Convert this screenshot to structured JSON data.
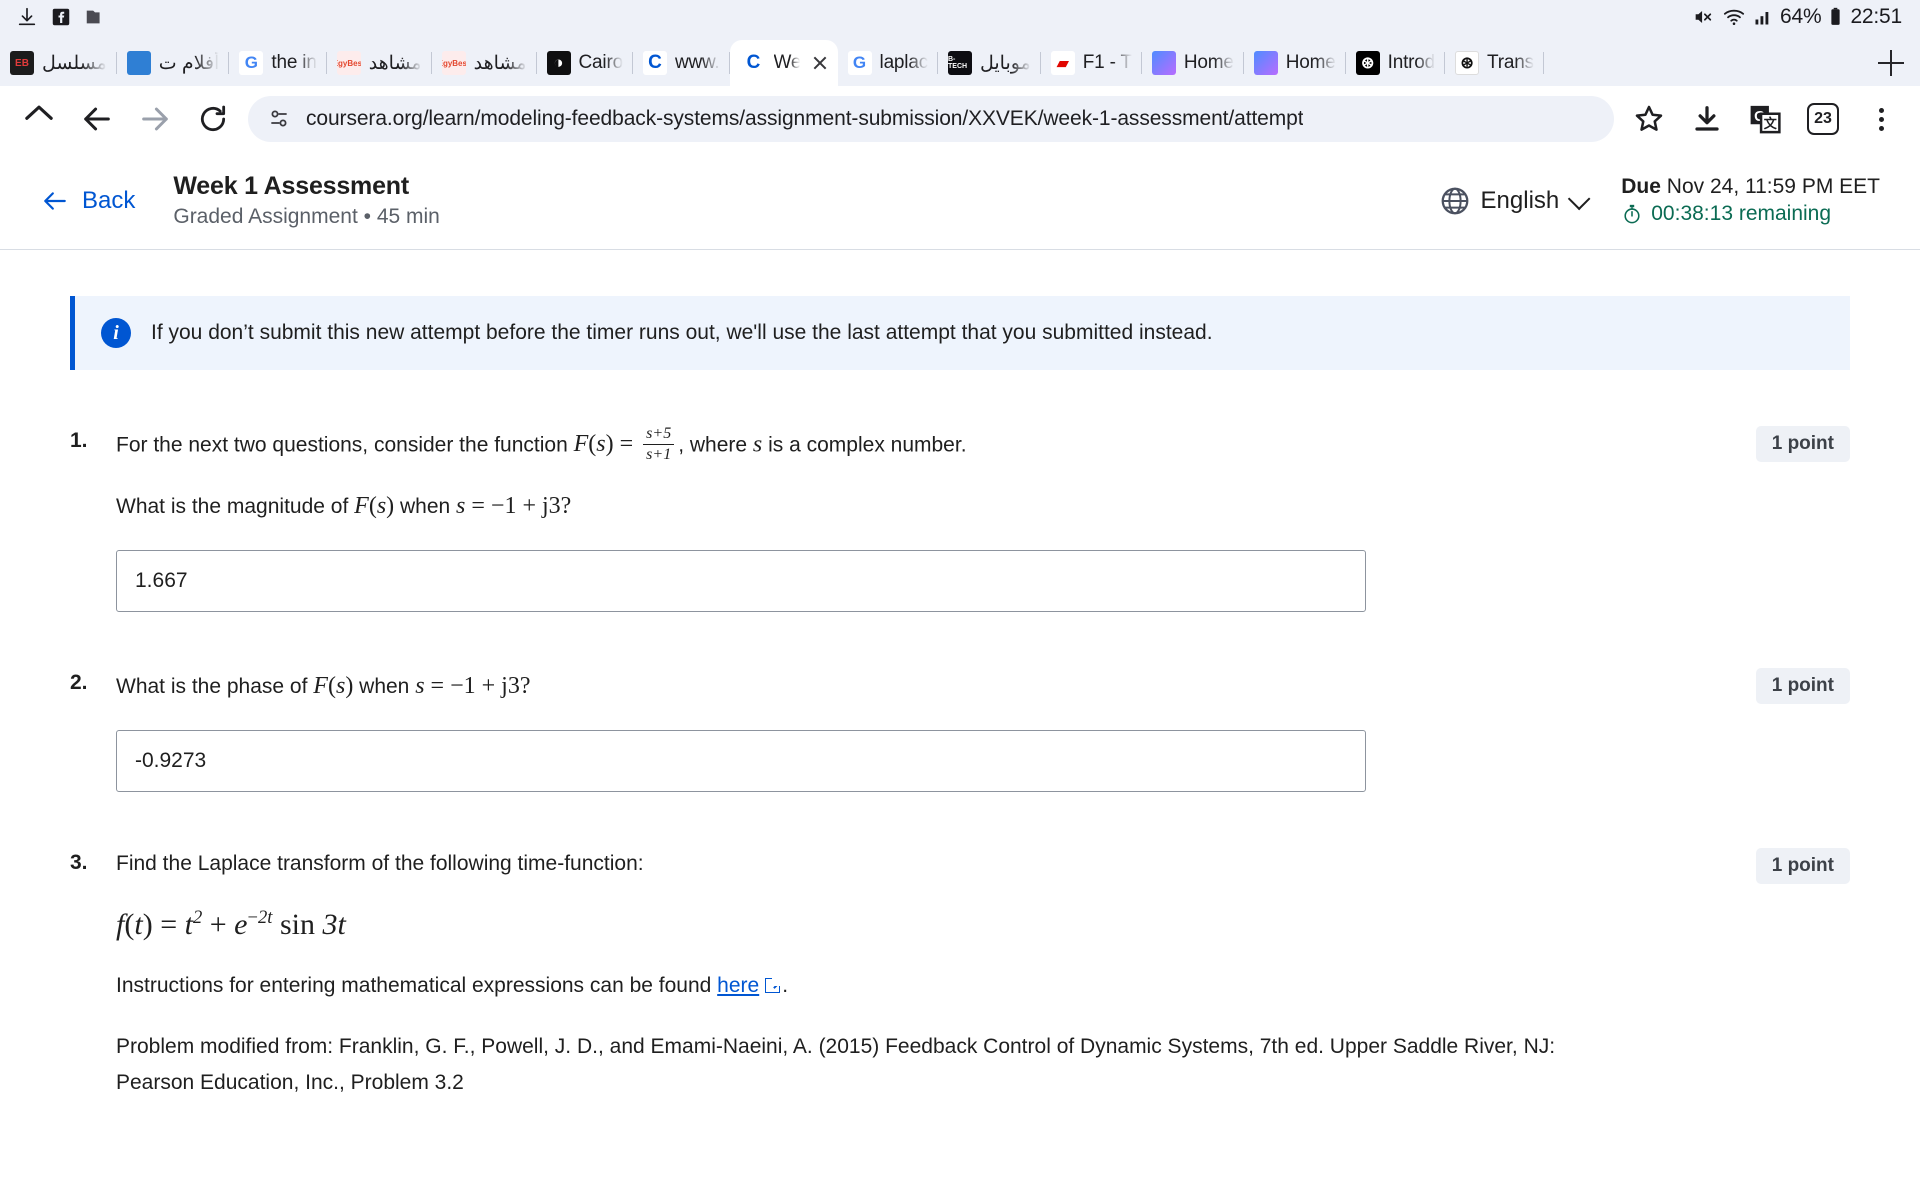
{
  "status_bar": {
    "left_icons": [
      "download-icon",
      "facebook-icon",
      "folder-icon"
    ],
    "mute_icon": "volume-mute-icon",
    "wifi_icon": "wifi-icon",
    "signal_icon": "cellular-signal-icon",
    "battery_percent": "64%",
    "battery_icon": "battery-icon",
    "clock": "22:51"
  },
  "tabs": [
    {
      "title": "مسلسل",
      "favicon": "eb-icon",
      "fav_text": "EB",
      "fav_class": "fv-eb",
      "active": false
    },
    {
      "title": "أفلام ت",
      "favicon": "aljazeera-icon",
      "fav_text": "",
      "fav_class": "fv-aj",
      "active": false
    },
    {
      "title": "the in",
      "favicon": "google-icon",
      "fav_text": "G",
      "fav_class": "fv-g",
      "active": false
    },
    {
      "title": "مشاهد",
      "favicon": "egybest-icon",
      "fav_text": "EgyBest",
      "fav_class": "fv-egy",
      "active": false
    },
    {
      "title": "مشاهد",
      "favicon": "egybest-icon",
      "fav_text": "EgyBest",
      "fav_class": "fv-egy",
      "active": false
    },
    {
      "title": "Cairo",
      "favicon": "globe-dark-icon",
      "fav_text": "◑",
      "fav_class": "fv-world",
      "active": false
    },
    {
      "title": "www.",
      "favicon": "coursera-icon",
      "fav_text": "C",
      "fav_class": "fv-c",
      "active": false
    },
    {
      "title": "We",
      "favicon": "coursera-icon",
      "fav_text": "C",
      "fav_class": "fv-c",
      "active": true
    },
    {
      "title": "laplac",
      "favicon": "google-icon",
      "fav_text": "G",
      "fav_class": "fv-g",
      "active": false
    },
    {
      "title": "موبايل",
      "favicon": "dark-site-icon",
      "fav_text": "B-TECH",
      "fav_class": "fv-dark",
      "active": false
    },
    {
      "title": "F1 - T",
      "favicon": "formula1-icon",
      "fav_text": "▰",
      "fav_class": "fv-f1",
      "active": false
    },
    {
      "title": "Home",
      "favicon": "gemini-icon",
      "fav_text": "",
      "fav_class": "fv-gem",
      "active": false
    },
    {
      "title": "Home",
      "favicon": "gemini-icon",
      "fav_text": "",
      "fav_class": "fv-gem",
      "active": false
    },
    {
      "title": "Introd",
      "favicon": "openai-icon",
      "fav_text": "⊛",
      "fav_class": "fv-oai",
      "active": false
    },
    {
      "title": "Trans",
      "favicon": "openai-icon",
      "fav_text": "⊛",
      "fav_class": "fv-oai2",
      "active": false
    }
  ],
  "new_tab_label": "+",
  "toolbar": {
    "home_icon": "home-icon",
    "back_icon": "back-arrow-icon",
    "forward_icon": "forward-arrow-icon",
    "reload_icon": "reload-icon",
    "permission_icon": "site-settings-icon",
    "url": "coursera.org/learn/modeling-feedback-systems/assignment-submission/XXVEK/week-1-assessment/attempt",
    "bookmark_icon": "star-icon",
    "download_icon": "download-icon",
    "translate_icon": "translate-icon",
    "tab_count": "23",
    "menu_icon": "three-dot-menu-icon"
  },
  "header": {
    "back_label": "Back",
    "back_icon": "arrow-left-icon",
    "title": "Week 1 Assessment",
    "subtitle": "Graded Assignment • 45 min",
    "language": "English",
    "globe_icon": "globe-icon",
    "chevron_icon": "chevron-down-icon",
    "due_label": "Due",
    "due_value": "Nov 24, 11:59 PM EET",
    "timer_icon": "stopwatch-icon",
    "time_remaining": "00:38:13 remaining"
  },
  "banner": {
    "icon": "info-circle-icon",
    "icon_glyph": "i",
    "text": "If you don’t submit this new attempt before the timer runs out, we'll use the last attempt that you submitted instead."
  },
  "questions": [
    {
      "number": "1.",
      "points": "1 point",
      "text_part1": "For the next two questions, consider the function",
      "math_F": "F",
      "math_s": "s",
      "math_eq": "=",
      "frac_num": "s+5",
      "frac_den": "s+1",
      "text_part2": ", where",
      "text_part3": "is a complex number.",
      "line2_pre": "What is the magnitude of",
      "line2_mid": "when",
      "line2_eq": "= −1 + j3?",
      "answer": "1.667"
    },
    {
      "number": "2.",
      "points": "1 point",
      "line_pre": "What is the phase of",
      "line_mid": "when",
      "line_eq": "= −1 + j3?",
      "answer": "-0.9273"
    },
    {
      "number": "3.",
      "points": "1 point",
      "prompt": "Find the Laplace transform of the following time-function:",
      "formula": "f(t) = t² + e^{−2t} sin 3t",
      "instructions_pre": "Instructions for entering mathematical expressions can be found",
      "instructions_link": "here",
      "link_icon": "external-link-icon",
      "instructions_post": ".",
      "citation": "Problem modified from: Franklin, G. F., Powell, J. D., and Emami-Naeini, A. (2015) Feedback Control of Dynamic Systems, 7th ed. Upper Saddle River, NJ:",
      "citation_cut": "Pearson Education, Inc., Problem 3.2"
    }
  ],
  "colors": {
    "accent": "#0056d2",
    "banner_bg": "#eef4fd",
    "timer_green": "#0b6b53",
    "chrome_bg": "#eef1f8"
  }
}
